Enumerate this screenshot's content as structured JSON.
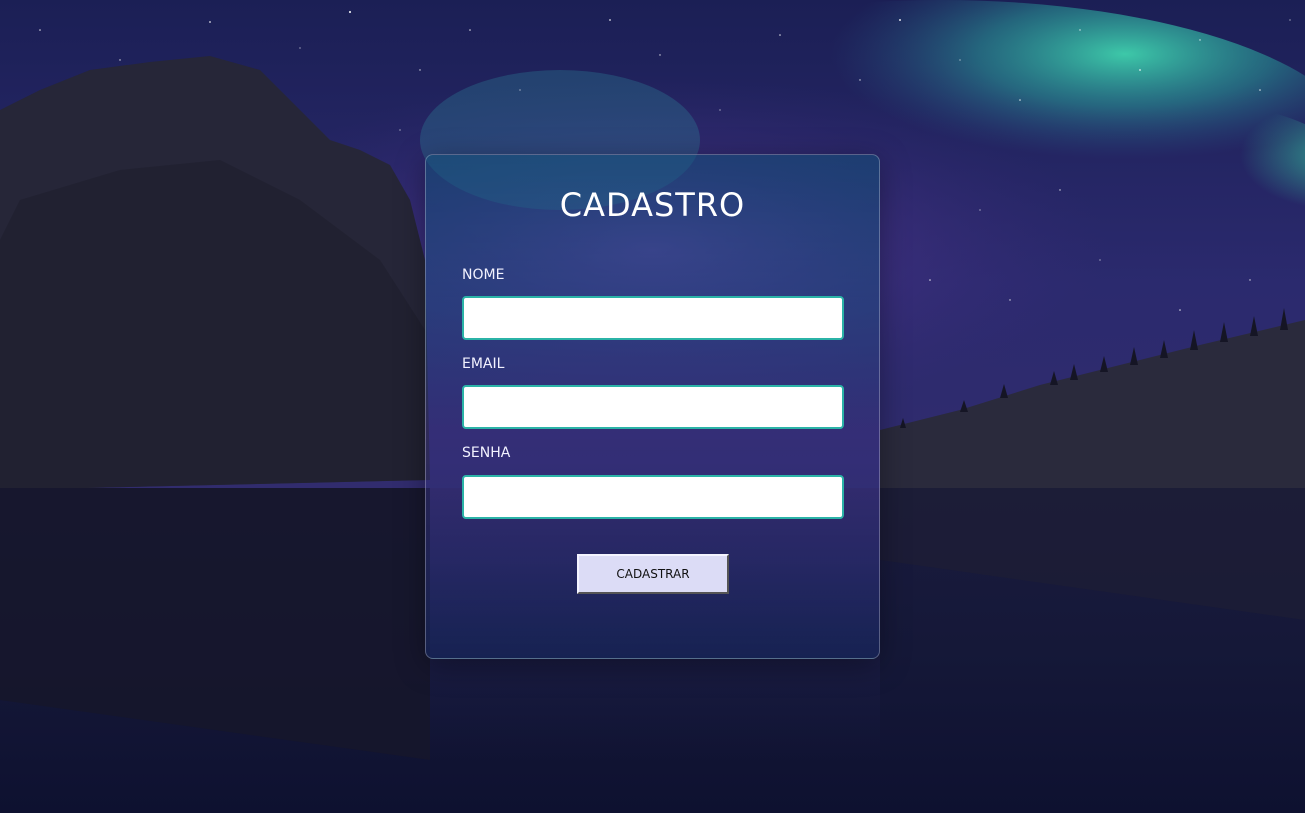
{
  "form": {
    "title": "CADASTRO",
    "fields": [
      {
        "label": "NOME",
        "value": "",
        "placeholder": ""
      },
      {
        "label": "EMAIL",
        "value": "",
        "placeholder": ""
      },
      {
        "label": "SENHA",
        "value": "",
        "placeholder": ""
      }
    ],
    "submit_label": "CADASTRAR"
  },
  "colors": {
    "input_border": "#2bb3a7",
    "button_bg": "#dcdcf6",
    "title_text": "#ffffff"
  }
}
